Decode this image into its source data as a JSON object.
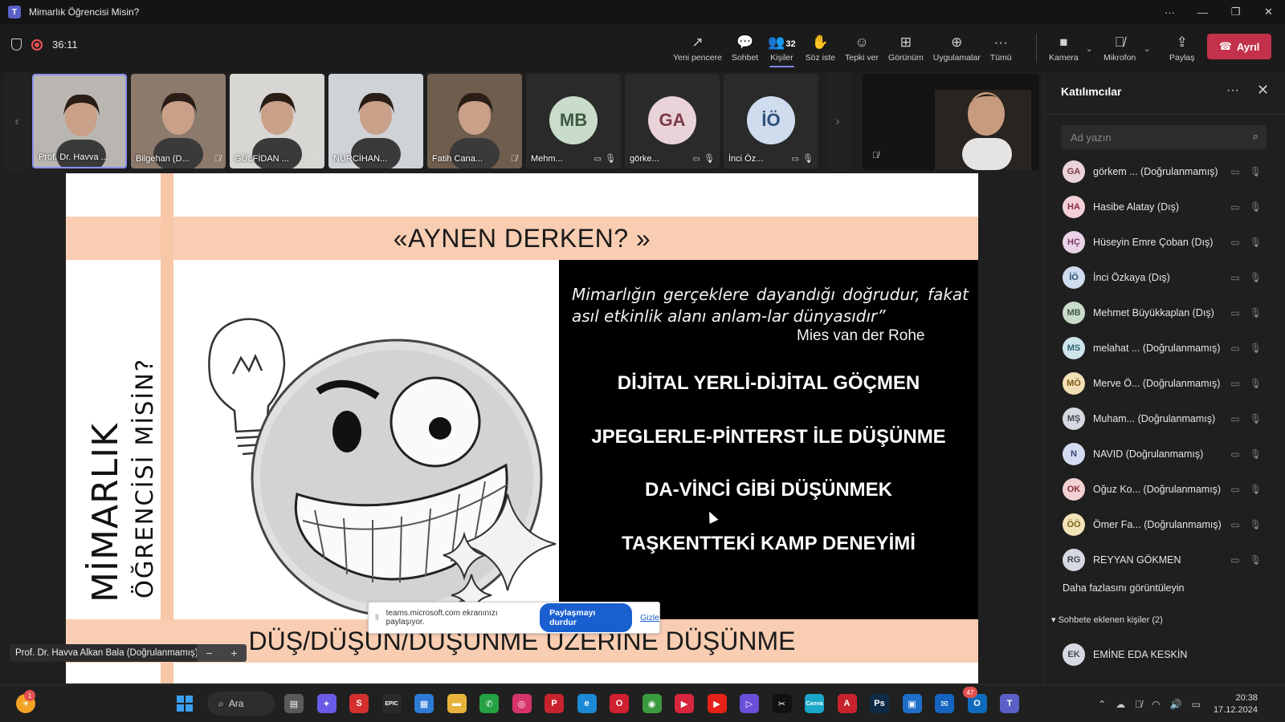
{
  "window": {
    "title": "Mimarlık Öğrencisi Misin?",
    "controls": [
      "···",
      "—",
      "❐",
      "✕"
    ]
  },
  "meeting": {
    "timer": "36:11",
    "toolbar": [
      {
        "id": "new-window",
        "label": "Yeni pencere",
        "icon": "↗"
      },
      {
        "id": "chat",
        "label": "Sohbet",
        "icon": "💬"
      },
      {
        "id": "people",
        "label": "Kişiler",
        "icon": "👥",
        "count": "32",
        "active": true
      },
      {
        "id": "raise-hand",
        "label": "Söz iste",
        "icon": "✋"
      },
      {
        "id": "react",
        "label": "Tepki ver",
        "icon": "☺"
      },
      {
        "id": "view",
        "label": "Görünüm",
        "icon": "⊞"
      },
      {
        "id": "apps",
        "label": "Uygulamalar",
        "icon": "⊕"
      },
      {
        "id": "more",
        "label": "Tümü",
        "icon": "···"
      }
    ],
    "camera_label": "Kamera",
    "mic_label": "Mikrofon",
    "share_label": "Paylaş",
    "leave_label": "Ayrıl"
  },
  "tiles": [
    {
      "name": "Prof. Dr. Havva ...",
      "speaking": true,
      "bg": "#b9b6b2",
      "mic": ""
    },
    {
      "name": "Bilgehan (D...",
      "bg": "#8c7a6c",
      "mic": "🎙̸"
    },
    {
      "name": "GÜLFİDAN ...",
      "bg": "#d8d6d2",
      "mic": "🎙̸"
    },
    {
      "name": "NURCİHAN...",
      "bg": "#cfd2d6",
      "mic": "🎙̸"
    },
    {
      "name": "Fatih Cana...",
      "bg": "#6f5d4d",
      "mic": "🎙̸"
    },
    {
      "name": "Mehm...",
      "initials": "MB",
      "av_bg": "#c9dccb",
      "av_fg": "#3d5a41",
      "cam": "▭",
      "mic": "🎙"
    },
    {
      "name": "görke...",
      "initials": "GA",
      "av_bg": "#ead3d8",
      "av_fg": "#7a3b4a",
      "cam": "▭",
      "mic": "🎙"
    },
    {
      "name": "İnci Öz...",
      "initials": "İÖ",
      "av_bg": "#cfdcee",
      "av_fg": "#2f4e7a",
      "cam": "▭",
      "mic": "🎙"
    }
  ],
  "slide": {
    "title": "«AYNEN DERKEN? »",
    "side_line1": "MİMARLIK",
    "side_line2": "ÖĞRENCİSİ MİSİN?",
    "quote": "Mimarlığın gerçeklere dayandığı doğrudur, fakat asıl etkinlik alanı anlam-lar dünyasıdır”",
    "author": "Mies van der Rohe",
    "bullets": [
      "DİJİTAL YERLİ-DİJİTAL GÖÇMEN",
      "JPEGLERLE-PİNTERST İLE DÜŞÜNME",
      "DA-VİNCİ GİBİ DÜŞÜNMEK",
      "TAŞKENTTEKİ KAMP DENEYİMİ"
    ],
    "bottom": "DÜŞ/DÜŞÜN/DÜŞÜNME ÜZERİNE DÜŞÜNME"
  },
  "share_bar": {
    "message": "teams.microsoft.com ekranınızı paylaşıyor.",
    "stop_label": "Paylaşmayı durdur",
    "hide_label": "Gizle"
  },
  "presenter": "Prof. Dr. Havva Alkan Bala (Doğrulanmamış)",
  "participants_panel": {
    "title": "Katılımcılar",
    "search_placeholder": "Ad yazın",
    "people": [
      {
        "initials": "GA",
        "name": "görkem ... (Doğrulanmamış)",
        "bg": "#ead3d8",
        "fg": "#7a3b4a"
      },
      {
        "initials": "HA",
        "name": "Hasibe Alatay (Dış)",
        "bg": "#f2d0d6",
        "fg": "#8a2f43"
      },
      {
        "initials": "HÇ",
        "name": "Hüseyin Emre Çoban (Dış)",
        "bg": "#ead3e6",
        "fg": "#7a3b6a"
      },
      {
        "initials": "İÖ",
        "name": "İnci Özkaya (Dış)",
        "bg": "#cfdcee",
        "fg": "#2f4e7a"
      },
      {
        "initials": "MB",
        "name": "Mehmet Büyükkaplan (Dış)",
        "bg": "#c9dccb",
        "fg": "#3d5a41"
      },
      {
        "initials": "MS",
        "name": "melahat ... (Doğrulanmamış)",
        "bg": "#cfe5ec",
        "fg": "#2f6474"
      },
      {
        "initials": "MÖ",
        "name": "Merve Ö... (Doğrulanmamış)",
        "bg": "#f3dfb5",
        "fg": "#7a5a18"
      },
      {
        "initials": "MŞ",
        "name": "Muham... (Doğrulanmamış)",
        "bg": "#d6d9e0",
        "fg": "#3f4656"
      },
      {
        "initials": "N",
        "name": "NAVID (Doğrulanmamış)",
        "bg": "#d5dcf2",
        "fg": "#34447a"
      },
      {
        "initials": "OK",
        "name": "Oğuz Ko... (Doğrulanmamış)",
        "bg": "#f2d0d3",
        "fg": "#8a2f38"
      },
      {
        "initials": "ÖÖ",
        "name": "Ömer Fa... (Doğrulanmamış)",
        "bg": "#f3e3b8",
        "fg": "#7a6318"
      },
      {
        "initials": "RG",
        "name": "REYYAN GÖKMEN",
        "bg": "#d6d9e0",
        "fg": "#3f4656"
      }
    ],
    "more_link": "Daha fazlasını görüntüleyin",
    "group_header": "Sohbete eklenen kişiler (2)",
    "group_people": [
      {
        "initials": "EK",
        "name": "EMİNE EDA KESKİN",
        "bg": "#d6d9e0",
        "fg": "#3f4656"
      }
    ]
  },
  "taskbar": {
    "search_label": "Ara",
    "notif_count": "1",
    "teams_badge": "47",
    "time": "20:38",
    "date": "17.12.2024",
    "apps": [
      {
        "id": "files",
        "label": "▤",
        "bg": "#5a5a5a"
      },
      {
        "id": "copilot",
        "label": "✦",
        "bg": "#6b5ce7"
      },
      {
        "id": "app-s",
        "label": "S",
        "bg": "#d32f2f"
      },
      {
        "id": "epic",
        "label": "EPIC",
        "bg": "#2a2a2a"
      },
      {
        "id": "store",
        "label": "▦",
        "bg": "#2e7bd6"
      },
      {
        "id": "explorer",
        "label": "▬",
        "bg": "#e8b33b"
      },
      {
        "id": "whatsapp",
        "label": "✆",
        "bg": "#25a244"
      },
      {
        "id": "instagram",
        "label": "◎",
        "bg": "#d6336c"
      },
      {
        "id": "pinterest",
        "label": "P",
        "bg": "#c8232c"
      },
      {
        "id": "edge",
        "label": "e",
        "bg": "#1c8ad6"
      },
      {
        "id": "opera",
        "label": "O",
        "bg": "#d1202f"
      },
      {
        "id": "chrome",
        "label": "◉",
        "bg": "#3a9a3e"
      },
      {
        "id": "player",
        "label": "▶",
        "bg": "#d7263d"
      },
      {
        "id": "youtube",
        "label": "▶",
        "bg": "#e62117"
      },
      {
        "id": "media",
        "label": "▷",
        "bg": "#6a4fd8"
      },
      {
        "id": "capcut",
        "label": "✂",
        "bg": "#111111"
      },
      {
        "id": "canva",
        "label": "Canva",
        "bg": "#1aa7c9"
      },
      {
        "id": "autocad",
        "label": "A",
        "bg": "#c8232c"
      },
      {
        "id": "photoshop",
        "label": "Ps",
        "bg": "#0e2a47"
      },
      {
        "id": "app-blue",
        "label": "▣",
        "bg": "#1f6fc8"
      },
      {
        "id": "outlook-new",
        "label": "✉",
        "bg": "#1565c0"
      },
      {
        "id": "outlook",
        "label": "O",
        "bg": "#0f6cbd"
      },
      {
        "id": "teams",
        "label": "T",
        "bg": "#5b5fc7"
      }
    ]
  }
}
